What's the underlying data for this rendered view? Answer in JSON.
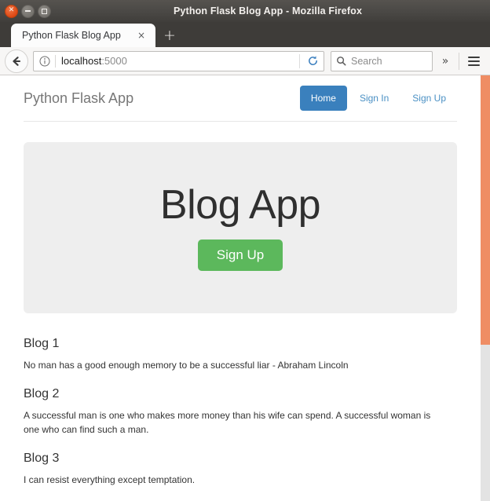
{
  "window": {
    "title": "Python Flask Blog App - Mozilla Firefox",
    "controls": {
      "close": "close-window",
      "minimize": "minimize-window",
      "maximize": "maximize-window"
    }
  },
  "tabs": {
    "items": [
      {
        "title": "Python Flask Blog App",
        "close_label": "×"
      }
    ],
    "new_tab_label": "+"
  },
  "toolbar": {
    "back_icon": "back-arrow-icon",
    "identity_icon": "info-icon",
    "url": {
      "host": "localhost",
      "port": ":5000",
      "full": "localhost:5000"
    },
    "reload_icon": "reload-icon",
    "search": {
      "placeholder": "Search",
      "icon": "search-icon"
    },
    "overflow_label": "»",
    "menu_icon": "hamburger-menu-icon"
  },
  "site": {
    "brand": "Python Flask App",
    "nav": [
      {
        "label": "Home",
        "active": true
      },
      {
        "label": "Sign In",
        "active": false
      },
      {
        "label": "Sign Up",
        "active": false
      }
    ],
    "hero": {
      "title": "Blog App",
      "cta_label": "Sign Up"
    },
    "posts": [
      {
        "title": "Blog 1",
        "body": "No man has a good enough memory to be a successful liar - Abraham Lincoln"
      },
      {
        "title": "Blog 2",
        "body": "A successful man is one who makes more money than his wife can spend. A successful woman is one who can find such a man."
      },
      {
        "title": "Blog 3",
        "body": "I can resist everything except temptation."
      }
    ]
  },
  "colors": {
    "nav_active": "#3a80bd",
    "nav_link": "#4a90c4",
    "cta_green": "#5cb85c",
    "hero_bg": "#eeeeee",
    "scrollbar_thumb": "#ef8d64"
  }
}
